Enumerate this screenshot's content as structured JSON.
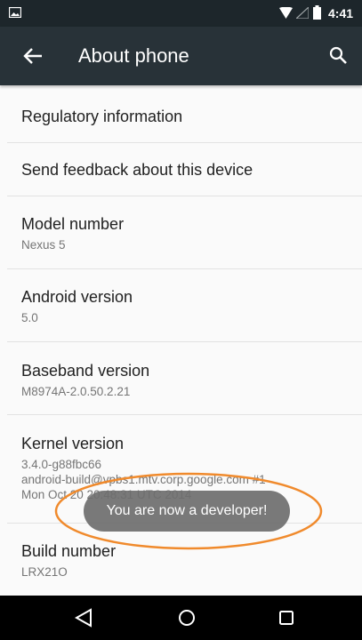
{
  "status_bar": {
    "time": "4:41",
    "icons": [
      "notification-image-icon",
      "wifi-icon",
      "signal-icon",
      "battery-icon"
    ]
  },
  "app_bar": {
    "title": "About phone",
    "icons": [
      "back-arrow-icon",
      "search-icon"
    ]
  },
  "list": [
    {
      "title": "Regulatory information"
    },
    {
      "title": "Send feedback about this device"
    },
    {
      "title": "Model number",
      "value": "Nexus 5"
    },
    {
      "title": "Android version",
      "value": "5.0"
    },
    {
      "title": "Baseband version",
      "value": "M8974A-2.0.50.2.21"
    },
    {
      "title": "Kernel version",
      "lines": [
        "3.4.0-g88fbc66",
        "android-build@vpbs1.mtv.corp.google.com #1",
        "Mon Oct 20 20:48:31 UTC 2014"
      ]
    },
    {
      "title": "Build number",
      "value": "LRX21O"
    }
  ],
  "toast": {
    "message": "You are now a developer!"
  },
  "nav_bar": {
    "icons": [
      "back-triangle-icon",
      "home-circle-icon",
      "recents-square-icon"
    ]
  },
  "colors": {
    "status_bar": "#1d262b",
    "app_bar": "#283238",
    "highlight_ring": "#f08a2c"
  }
}
